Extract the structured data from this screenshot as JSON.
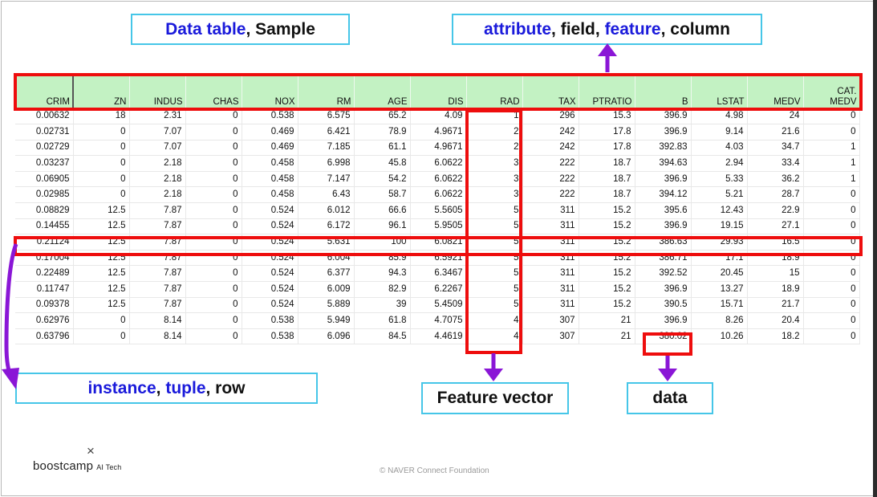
{
  "callouts": {
    "table": {
      "key1": "Data table",
      "rest": ", Sample"
    },
    "attribute": {
      "k1": "attribute",
      "s1": ", field, ",
      "k2": "feature",
      "s2": ", column"
    },
    "instance": {
      "k1": "instance",
      "s1": ", ",
      "k2": "tuple",
      "s2": ", row"
    },
    "feature_vector": "Feature vector",
    "data": "data"
  },
  "table": {
    "headers": [
      "CRIM",
      "ZN",
      "INDUS",
      "CHAS",
      "NOX",
      "RM",
      "AGE",
      "DIS",
      "RAD",
      "TAX",
      "PTRATIO",
      "B",
      "LSTAT",
      "MEDV",
      "CAT. MEDV"
    ],
    "rows": [
      [
        "0.00632",
        "18",
        "2.31",
        "0",
        "0.538",
        "6.575",
        "65.2",
        "4.09",
        "1",
        "296",
        "15.3",
        "396.9",
        "4.98",
        "24",
        "0"
      ],
      [
        "0.02731",
        "0",
        "7.07",
        "0",
        "0.469",
        "6.421",
        "78.9",
        "4.9671",
        "2",
        "242",
        "17.8",
        "396.9",
        "9.14",
        "21.6",
        "0"
      ],
      [
        "0.02729",
        "0",
        "7.07",
        "0",
        "0.469",
        "7.185",
        "61.1",
        "4.9671",
        "2",
        "242",
        "17.8",
        "392.83",
        "4.03",
        "34.7",
        "1"
      ],
      [
        "0.03237",
        "0",
        "2.18",
        "0",
        "0.458",
        "6.998",
        "45.8",
        "6.0622",
        "3",
        "222",
        "18.7",
        "394.63",
        "2.94",
        "33.4",
        "1"
      ],
      [
        "0.06905",
        "0",
        "2.18",
        "0",
        "0.458",
        "7.147",
        "54.2",
        "6.0622",
        "3",
        "222",
        "18.7",
        "396.9",
        "5.33",
        "36.2",
        "1"
      ],
      [
        "0.02985",
        "0",
        "2.18",
        "0",
        "0.458",
        "6.43",
        "58.7",
        "6.0622",
        "3",
        "222",
        "18.7",
        "394.12",
        "5.21",
        "28.7",
        "0"
      ],
      [
        "0.08829",
        "12.5",
        "7.87",
        "0",
        "0.524",
        "6.012",
        "66.6",
        "5.5605",
        "5",
        "311",
        "15.2",
        "395.6",
        "12.43",
        "22.9",
        "0"
      ],
      [
        "0.14455",
        "12.5",
        "7.87",
        "0",
        "0.524",
        "6.172",
        "96.1",
        "5.9505",
        "5",
        "311",
        "15.2",
        "396.9",
        "19.15",
        "27.1",
        "0"
      ],
      [
        "0.21124",
        "12.5",
        "7.87",
        "0",
        "0.524",
        "5.631",
        "100",
        "6.0821",
        "5",
        "311",
        "15.2",
        "386.63",
        "29.93",
        "16.5",
        "0"
      ],
      [
        "0.17004",
        "12.5",
        "7.87",
        "0",
        "0.524",
        "6.004",
        "85.9",
        "6.5921",
        "5",
        "311",
        "15.2",
        "386.71",
        "17.1",
        "18.9",
        "0"
      ],
      [
        "0.22489",
        "12.5",
        "7.87",
        "0",
        "0.524",
        "6.377",
        "94.3",
        "6.3467",
        "5",
        "311",
        "15.2",
        "392.52",
        "20.45",
        "15",
        "0"
      ],
      [
        "0.11747",
        "12.5",
        "7.87",
        "0",
        "0.524",
        "6.009",
        "82.9",
        "6.2267",
        "5",
        "311",
        "15.2",
        "396.9",
        "13.27",
        "18.9",
        "0"
      ],
      [
        "0.09378",
        "12.5",
        "7.87",
        "0",
        "0.524",
        "5.889",
        "39",
        "5.4509",
        "5",
        "311",
        "15.2",
        "390.5",
        "15.71",
        "21.7",
        "0"
      ],
      [
        "0.62976",
        "0",
        "8.14",
        "0",
        "0.538",
        "5.949",
        "61.8",
        "4.7075",
        "4",
        "307",
        "21",
        "396.9",
        "8.26",
        "20.4",
        "0"
      ],
      [
        "0.63796",
        "0",
        "8.14",
        "0",
        "0.538",
        "6.096",
        "84.5",
        "4.4619",
        "4",
        "307",
        "21",
        "380.02",
        "10.26",
        "18.2",
        "0"
      ]
    ]
  },
  "colors": {
    "highlight": "#ee0d0d",
    "arrow": "#8a16d6",
    "callout_border": "#46c6e8",
    "keyword": "#1a1adb",
    "header_bg": "#c3f2c3"
  },
  "footer": {
    "logo_mark": "×",
    "brand": "boostcamp",
    "brand_sub": "AI Tech",
    "copyright": "© NAVER Connect Foundation"
  }
}
